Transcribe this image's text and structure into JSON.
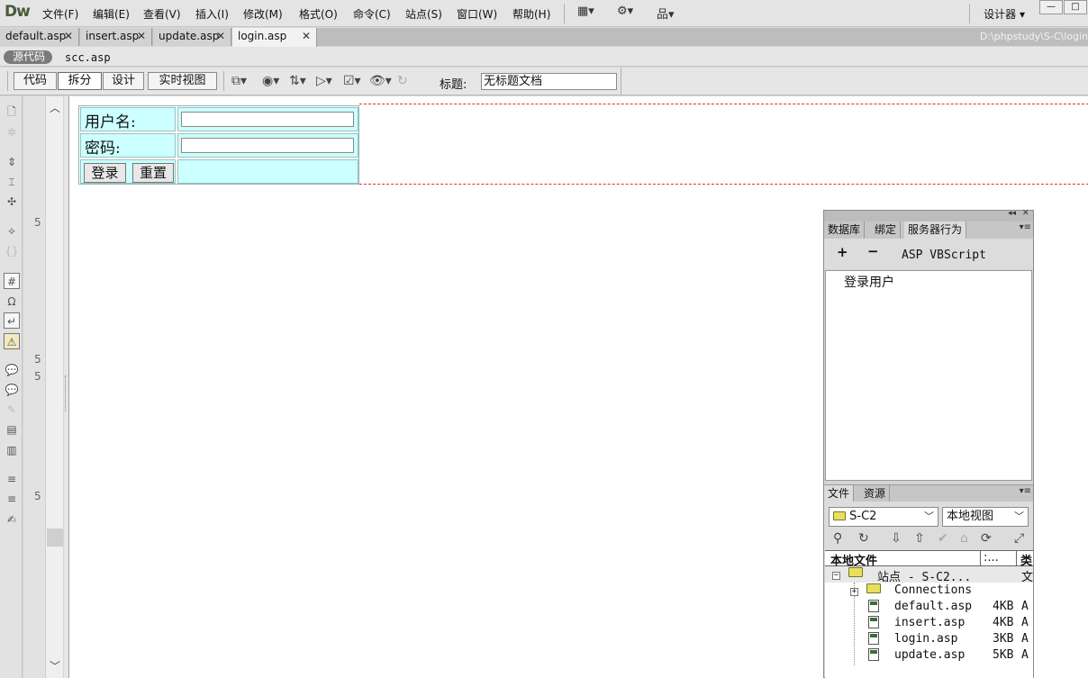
{
  "app": {
    "logo": "Dw"
  },
  "menu": {
    "items": [
      "文件(F)",
      "编辑(E)",
      "查看(V)",
      "插入(I)",
      "修改(M)",
      "格式(O)",
      "命令(C)",
      "站点(S)",
      "窗口(W)",
      "帮助(H)"
    ],
    "workspace": "设计器"
  },
  "tabs": [
    {
      "label": "default.asp",
      "active": false
    },
    {
      "label": "insert.asp",
      "active": false
    },
    {
      "label": "update.asp",
      "active": false
    },
    {
      "label": "login.asp",
      "active": true
    }
  ],
  "path": "D:\\phpstudy\\S-C\\login",
  "related": {
    "source": "源代码",
    "file": "scc.asp"
  },
  "doc_toolbar": {
    "views": [
      "代码",
      "拆分",
      "设计",
      "实时视图"
    ],
    "active_view": "拆分",
    "title_label": "标题:",
    "title_value": "无标题文档"
  },
  "gutter": {
    "line_numbers": [
      "5",
      "5",
      "5",
      "5"
    ]
  },
  "form": {
    "username_label": "用户名:",
    "password_label": "密码:",
    "login_button": "登录",
    "reset_button": "重置",
    "username_value": "",
    "password_value": ""
  },
  "server_panel": {
    "tabs": [
      "数据库",
      "绑定",
      "服务器行为"
    ],
    "active_tab": "服务器行为",
    "add": "+",
    "remove": "−",
    "language": "ASP VBScript",
    "behaviors": [
      "登录用户"
    ]
  },
  "files_panel": {
    "tabs": [
      "文件",
      "资源"
    ],
    "site_select": "S-C2",
    "view_select": "本地视图",
    "header": {
      "name": "本地文件",
      "size": ":...",
      "type": "类"
    },
    "root": {
      "label": "站点 - S-C2...",
      "type": "文"
    },
    "files": [
      {
        "name": "Connections",
        "size": "",
        "type": "",
        "folder": true
      },
      {
        "name": "default.asp",
        "size": "4KB",
        "type": "A",
        "folder": false
      },
      {
        "name": "insert.asp",
        "size": "4KB",
        "type": "A",
        "folder": false
      },
      {
        "name": "login.asp",
        "size": "3KB",
        "type": "A",
        "folder": false
      },
      {
        "name": "update.asp",
        "size": "5KB",
        "type": "A",
        "folder": false
      }
    ]
  },
  "colors": {
    "form_cell": "#ccffff",
    "dashed_border": "#e03030"
  }
}
